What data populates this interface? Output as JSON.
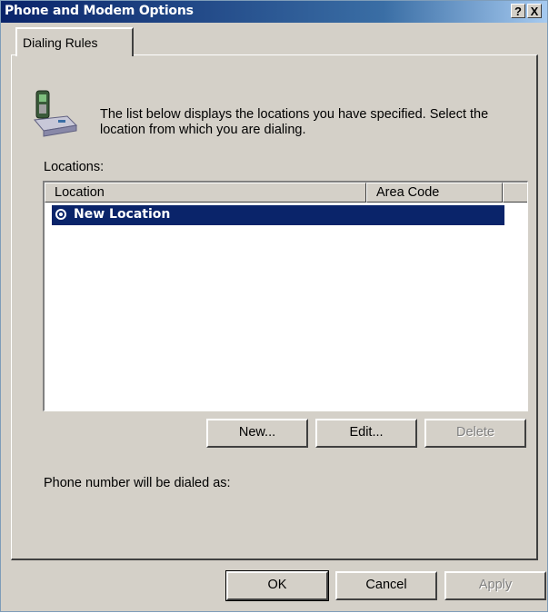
{
  "window": {
    "title": "Phone and Modem Options",
    "help_button": "?",
    "close_button": "X"
  },
  "tabs": [
    {
      "label": "Dialing Rules",
      "selected": true
    }
  ],
  "intro_text": "The list below displays the locations you have specified. Select the location from which you are dialing.",
  "locations_label": "Locations:",
  "locations_table": {
    "columns": [
      "Location",
      "Area Code"
    ],
    "rows": [
      {
        "location": "New Location",
        "area_code": "",
        "selected": true
      }
    ]
  },
  "list_buttons": {
    "new": "New...",
    "edit": "Edit...",
    "delete": "Delete"
  },
  "dialed_as_label": "Phone number will be dialed as:",
  "dialog_buttons": {
    "ok": "OK",
    "cancel": "Cancel",
    "apply": "Apply"
  },
  "icons": {
    "location": "phone-modem-icon",
    "selected_row": "radio-selected-icon"
  },
  "colors": {
    "titlebar_start": "#0a246a",
    "titlebar_end": "#a6caf0",
    "selection": "#0a246a",
    "face": "#d4d0c8"
  }
}
